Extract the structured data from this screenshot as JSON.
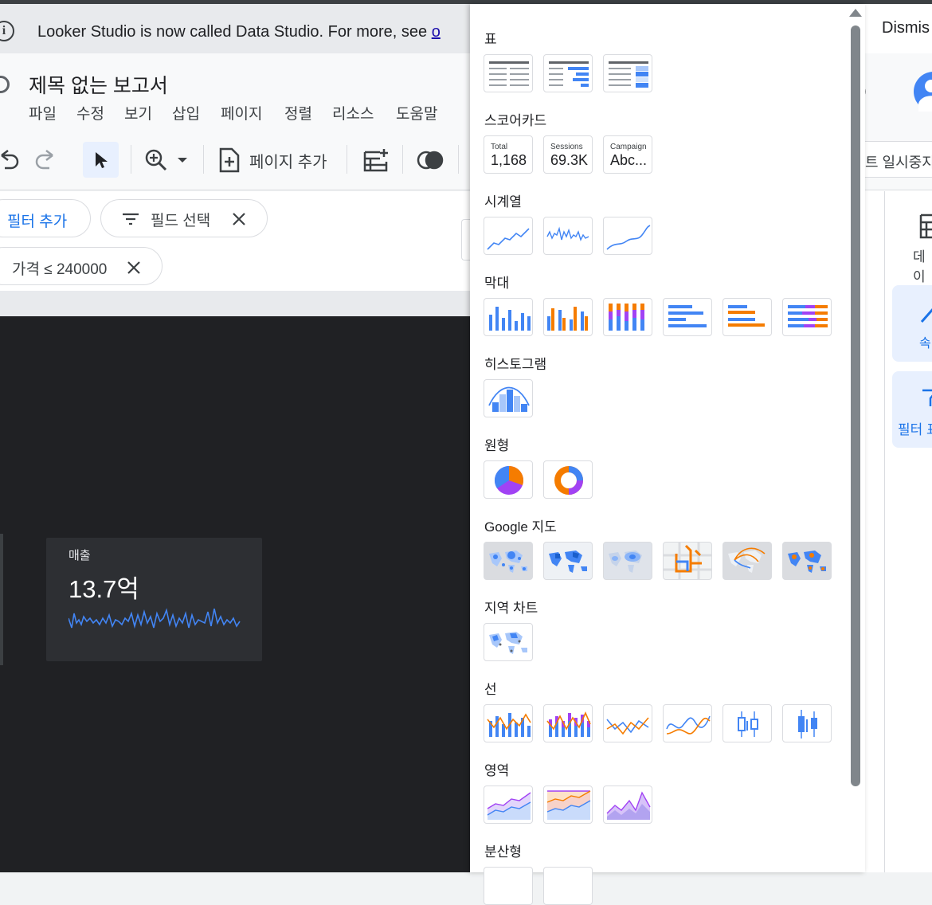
{
  "banner": {
    "text": "Looker Studio is now called Data Studio. For more, see ",
    "link": "o",
    "dismiss": "Dismis"
  },
  "header": {
    "title": "제목 없는 보고서",
    "menus": [
      "파일",
      "수정",
      "보기",
      "삽입",
      "페이지",
      "정렬",
      "리소스",
      "도움말"
    ]
  },
  "toolbar": {
    "add_page": "페이지 추가",
    "pause": "트 일시중지"
  },
  "filters": {
    "add_filter": "필터 추가",
    "field_select": "필드 선택",
    "price_filter": "가격 ≤ 240000"
  },
  "scorecard": {
    "label": "매출",
    "value": "13.7억"
  },
  "right_panel": {
    "data_label": "데이",
    "props_label": "속",
    "filter_label": "필터 표"
  },
  "chart_menu": {
    "sections": {
      "table": "표",
      "scorecard": "스코어카드",
      "timeseries": "시계열",
      "bar": "막대",
      "histogram": "히스토그램",
      "pie": "원형",
      "google_maps": "Google 지도",
      "geo": "지역 차트",
      "line": "선",
      "area": "영역",
      "scatter": "분산형"
    },
    "scorecards": [
      {
        "label": "Total",
        "value": "1,168"
      },
      {
        "label": "Sessions",
        "value": "69.3K"
      },
      {
        "label": "Campaign",
        "value": "Abc..."
      }
    ]
  },
  "colors": {
    "blue": "#4285f4",
    "orange": "#f57c00",
    "purple": "#a142f4",
    "canvas": "#202124"
  }
}
